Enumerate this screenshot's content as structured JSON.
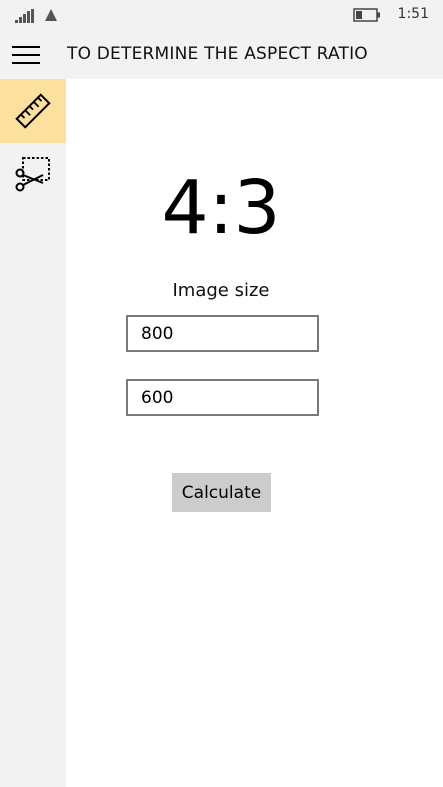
{
  "status_bar": {
    "time": "1:51",
    "icons": [
      "signal-strength-icon",
      "network-icon",
      "battery-icon"
    ]
  },
  "header": {
    "title": "TO DETERMINE THE ASPECT RATIO",
    "menu_icon": "hamburger-icon"
  },
  "nav": {
    "items": [
      {
        "icon": "ruler-icon",
        "active": true
      },
      {
        "icon": "crop-scissors-icon",
        "active": false
      }
    ]
  },
  "main": {
    "result": "4:3",
    "image_size_label": "Image size",
    "width_value": "800",
    "height_value": "600",
    "calculate_label": "Calculate"
  },
  "colors": {
    "chrome_background": "#f2f2f2",
    "active_nav": "#fbe09e",
    "button_background": "#cccccc",
    "input_border": "#7a7a7a"
  }
}
